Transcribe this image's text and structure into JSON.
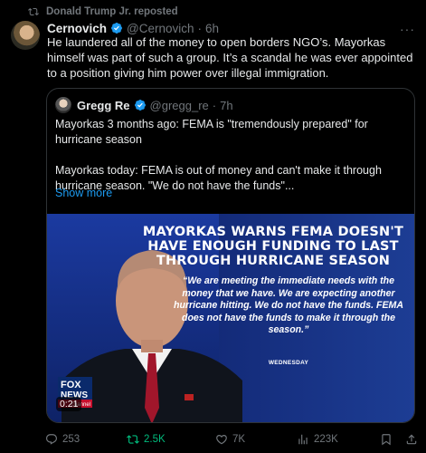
{
  "repost": {
    "label": "Donald Trump Jr. reposted"
  },
  "tweet": {
    "name": "Cernovich",
    "handle": "@Cernovich",
    "separator": "·",
    "time": "6h",
    "text": "He laundered all of the money to open borders NGO’s. Mayorkas himself was part of such a group. It’s a scandal he was ever appointed to a position giving him power over illegal immigration.",
    "more_icon": "more-dots-icon"
  },
  "quote": {
    "name": "Gregg Re",
    "handle": "@gregg_re",
    "separator": "·",
    "time": "7h",
    "paragraph1": "Mayorkas 3 months ago: FEMA is \"tremendously prepared\" for hurricane season",
    "paragraph2": "Mayorkas today: FEMA is out of money and can't make it through hurricane season. \"We do not have the funds\"...",
    "show_more": "Show more"
  },
  "media": {
    "headline": "MAYORKAS WARNS FEMA DOESN'T HAVE ENOUGH FUNDING TO LAST THROUGH HURRICANE SEASON",
    "quote": "“We are meeting the immediate needs with the money that we have. We are expecting another hurricane hitting. We do not have the funds. FEMA does not have the funds to make it through the season.”",
    "day_tag": "WEDNESDAY",
    "duration": "0:21",
    "logo_line1": "FOX",
    "logo_line2": "NEWS",
    "logo_line3": "channel"
  },
  "actions": {
    "replies": "253",
    "reposts": "2.5K",
    "likes": "7K",
    "views": "223K"
  },
  "colors": {
    "background": "#000000",
    "text": "#e7e9ea",
    "muted": "#71767b",
    "accent_blue": "#1d9bf0",
    "repost_green": "#00ba7c",
    "border": "#2f3336"
  }
}
